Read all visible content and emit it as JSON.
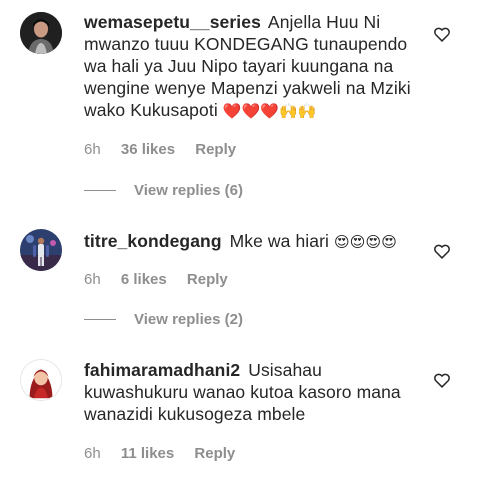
{
  "comments": [
    {
      "username": "wemasepetu__series",
      "text": "Anjella Huu Ni mwanzo tuuu KONDEGANG tunaupendo wa hali ya Juu Nipo tayari kuungana na wengine wenye Mapenzi yakweli na Mziki wako Kukusapoti",
      "emoji": "❤️❤️❤️🙌🙌",
      "time": "6h",
      "likes": "36 likes",
      "reply": "Reply",
      "view_replies": "View replies (6)"
    },
    {
      "username": "titre_kondegang",
      "text": "Mke wa hiari",
      "emoji": "😍😍😍😍",
      "time": "6h",
      "likes": "6 likes",
      "reply": "Reply",
      "view_replies": "View replies (2)"
    },
    {
      "username": "fahimaramadhani2",
      "text": "Usisahau kuwashukuru wanao kutoa kasoro mana wanazidi kukusogeza mbele",
      "emoji": "",
      "time": "6h",
      "likes": "11 likes",
      "reply": "Reply"
    }
  ],
  "icons": {
    "like": "heart-outline-icon"
  },
  "colors": {
    "text": "#262626",
    "secondary": "#8e8e8e",
    "heart": "#e0245e"
  }
}
